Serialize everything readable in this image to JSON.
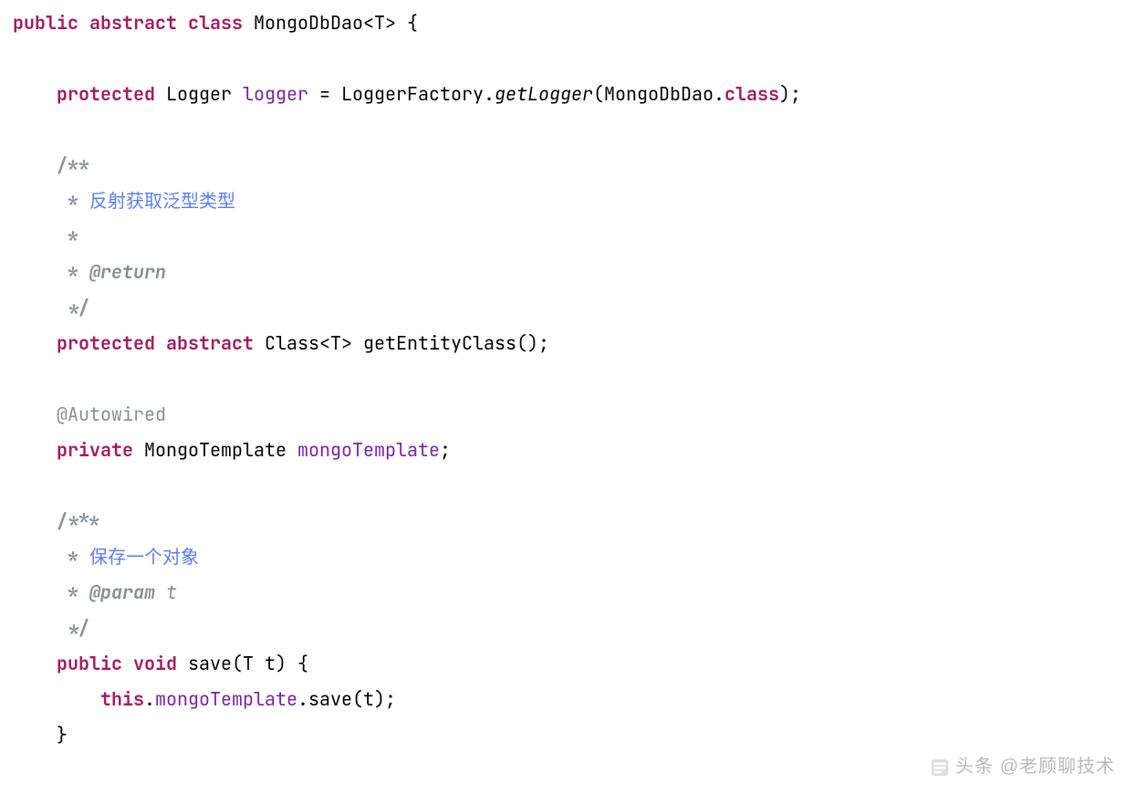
{
  "code": {
    "l1": {
      "kw1": "public",
      "kw2": "abstract",
      "kw3": "class",
      "name": "MongoDbDao",
      "generic": "<T>",
      "brace": " {"
    },
    "l3": {
      "kw": "protected",
      "type": "Logger",
      "var": "logger",
      "eq": " = ",
      "factory": "LoggerFactory.",
      "call": "getLogger",
      "args": "(MongoDbDao.",
      "kw2": "class",
      "close": ");"
    },
    "l5": "/**",
    "l6_star": " * ",
    "l6_text": "反射获取泛型类型",
    "l7": " *",
    "l8_star": " * ",
    "l8_tag": "@return",
    "l9": " */",
    "l10": {
      "kw1": "protected",
      "kw2": "abstract",
      "ret": "Class<T>",
      "name": "getEntityClass",
      "paren": "();"
    },
    "l12": "@Autowired",
    "l13": {
      "kw": "private",
      "type": "MongoTemplate",
      "var": "mongoTemplate",
      "semi": ";"
    },
    "l15": "/***",
    "l16_star": " * ",
    "l16_text": "保存一个对象",
    "l17_star": " * ",
    "l17_tag": "@param",
    "l17_name": " t",
    "l18": " */",
    "l19": {
      "kw1": "public",
      "kw2": "void",
      "name": "save",
      "args": "(T t)",
      "brace": " {"
    },
    "l20": {
      "indent": "    ",
      "this": "this",
      "dot1": ".",
      "tmpl": "mongoTemplate",
      "dot2": ".",
      "call": "save",
      "args": "(t);"
    },
    "l21": "}"
  },
  "watermark": "头条 @老顾聊技术"
}
